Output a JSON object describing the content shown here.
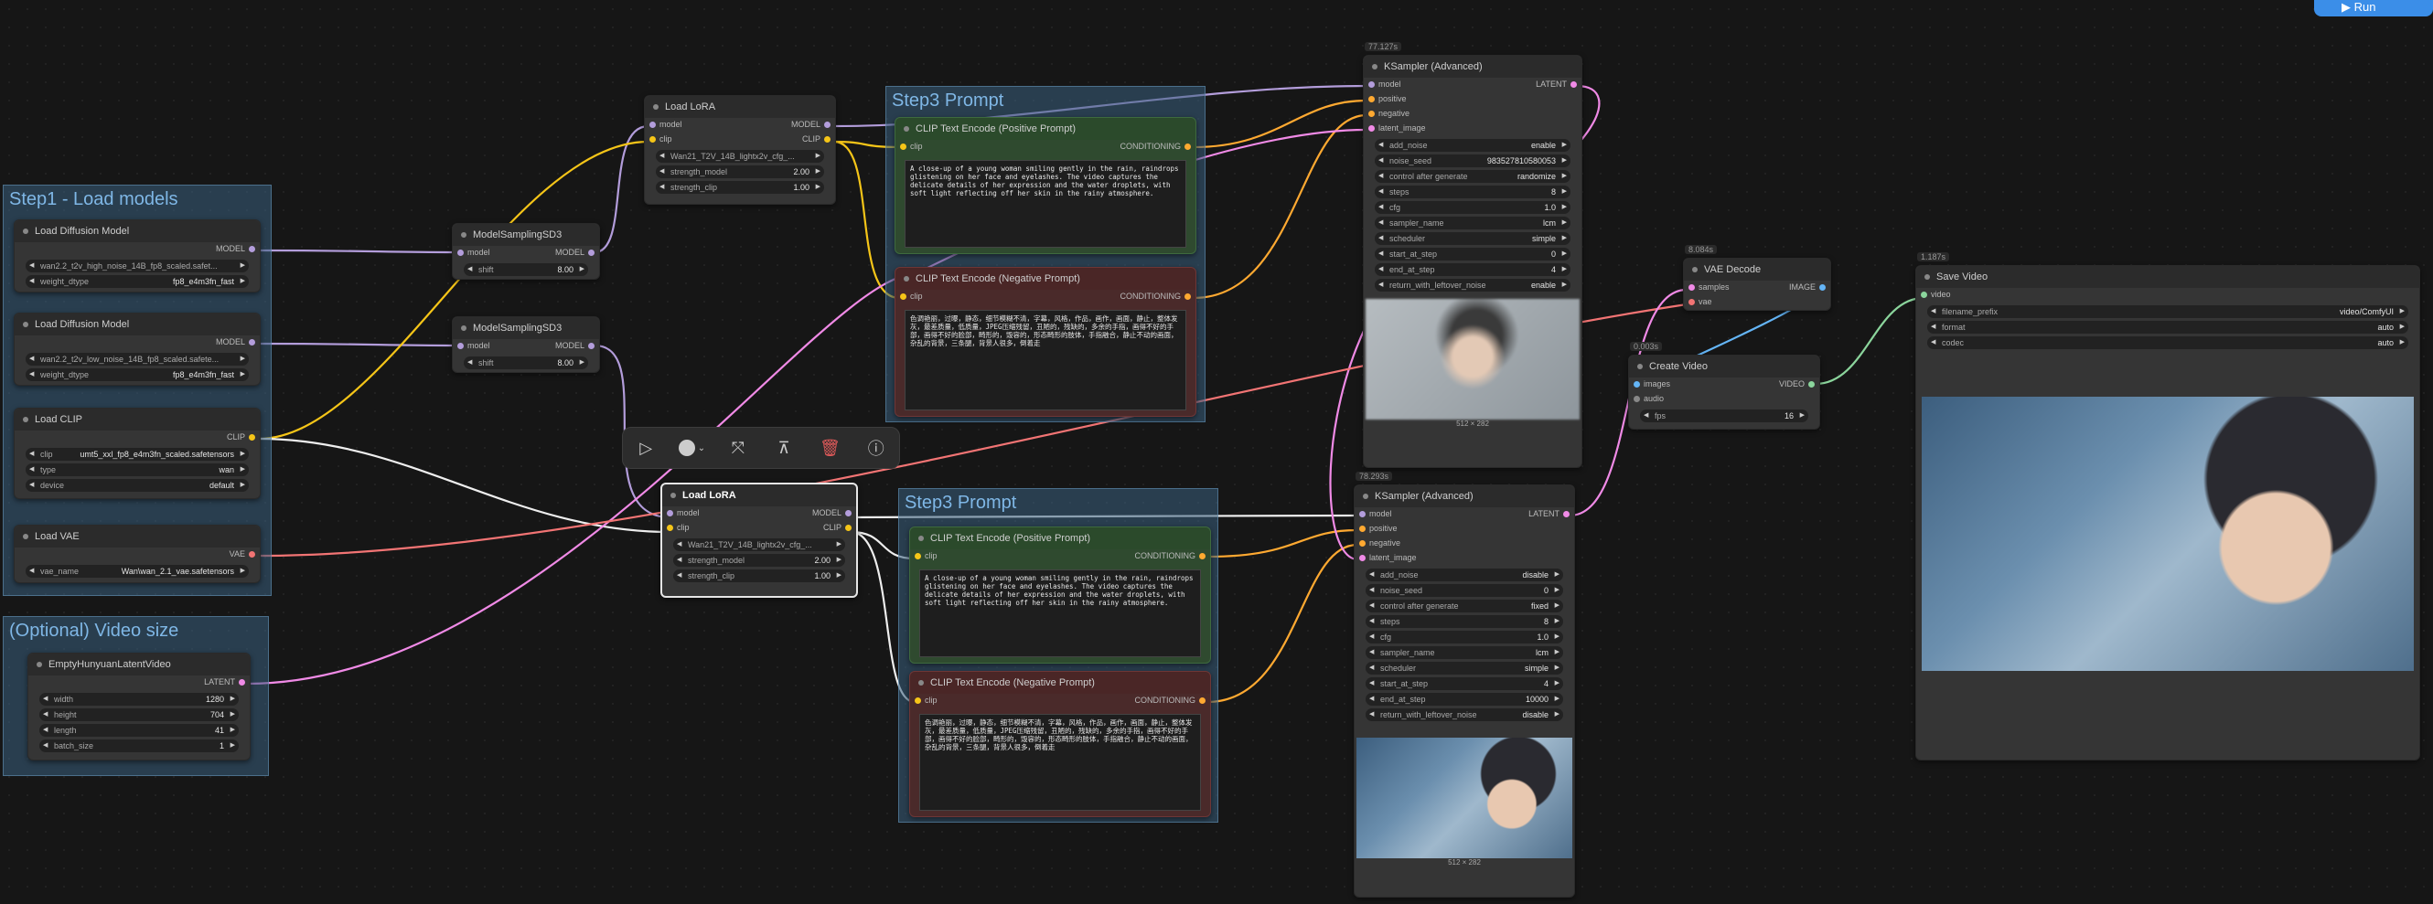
{
  "run_button": {
    "label": "Run"
  },
  "groups": {
    "step1": "Step1 - Load models",
    "video_size": "(Optional) Video size",
    "step3_top": "Step3 Prompt",
    "step3_bottom": "Step3 Prompt"
  },
  "nodes": {
    "ldm_high": {
      "title": "Load Diffusion Model",
      "out": "MODEL",
      "unet_name": "wan2.2_t2v_high_noise_14B_fp8_scaled.safet...",
      "weight_dtype_label": "weight_dtype",
      "weight_dtype": "fp8_e4m3fn_fast"
    },
    "ldm_low": {
      "title": "Load Diffusion Model",
      "out": "MODEL",
      "unet_name": "wan2.2_t2v_low_noise_14B_fp8_scaled.safete...",
      "weight_dtype_label": "weight_dtype",
      "weight_dtype": "fp8_e4m3fn_fast"
    },
    "clip": {
      "title": "Load CLIP",
      "out": "CLIP",
      "clip_label": "clip",
      "clip_name": "umt5_xxl_fp8_e4m3fn_scaled.safetensors",
      "type_label": "type",
      "type": "wan",
      "device_label": "device",
      "device": "default"
    },
    "vae": {
      "title": "Load VAE",
      "out": "VAE",
      "vae_label": "vae_name",
      "vae_name": "Wan\\wan_2.1_vae.safetensors"
    },
    "latent": {
      "title": "EmptyHunyuanLatentVideo",
      "out": "LATENT",
      "width_label": "width",
      "width": "1280",
      "height_label": "height",
      "height": "704",
      "length_label": "length",
      "length": "41",
      "batch_label": "batch_size",
      "batch": "1"
    },
    "msd1": {
      "title": "ModelSamplingSD3",
      "in": "model",
      "out": "MODEL",
      "shift_label": "shift",
      "shift": "8.00"
    },
    "msd2": {
      "title": "ModelSamplingSD3",
      "in": "model",
      "out": "MODEL",
      "shift_label": "shift",
      "shift": "8.00"
    },
    "lora1": {
      "title": "Load LoRA",
      "in1": "model",
      "in2": "clip",
      "out1": "MODEL",
      "out2": "CLIP",
      "lora_name": "Wan21_T2V_14B_lightx2v_cfg_...",
      "sm_label": "strength_model",
      "sm": "2.00",
      "sc_label": "strength_clip",
      "sc": "1.00"
    },
    "lora2": {
      "title": "Load LoRA",
      "in1": "model",
      "in2": "clip",
      "out1": "MODEL",
      "out2": "CLIP",
      "lora_name": "Wan21_T2V_14B_lightx2v_cfg_...",
      "sm_label": "strength_model",
      "sm": "2.00",
      "sc_label": "strength_clip",
      "sc": "1.00"
    },
    "pos1": {
      "title": "CLIP Text Encode (Positive Prompt)",
      "in": "clip",
      "out": "CONDITIONING",
      "text": "A close-up of a young woman smiling gently in the rain, raindrops glistening on her face and eyelashes. The video captures the delicate details of her expression and the water droplets, with soft light reflecting off her skin in the rainy atmosphere."
    },
    "neg1": {
      "title": "CLIP Text Encode (Negative Prompt)",
      "in": "clip",
      "out": "CONDITIONING",
      "text": "色调艳丽，过曝，静态，细节模糊不清，字幕，风格，作品，画作，画面，静止，整体发灰，最差质量，低质量，JPEG压缩残留，丑陋的，残缺的，多余的手指，画得不好的手部，画得不好的脸部，畸形的，毁容的，形态畸形的肢体，手指融合，静止不动的画面，杂乱的背景，三条腿，背景人很多，倒着走"
    },
    "pos2": {
      "title": "CLIP Text Encode (Positive Prompt)",
      "in": "clip",
      "out": "CONDITIONING",
      "text": "A close-up of a young woman smiling gently in the rain, raindrops glistening on her face and eyelashes. The video captures the delicate details of her expression and the water droplets, with soft light reflecting off her skin in the rainy atmosphere."
    },
    "neg2": {
      "title": "CLIP Text Encode (Negative Prompt)",
      "in": "clip",
      "out": "CONDITIONING",
      "text": "色调艳丽，过曝，静态，细节模糊不清，字幕，风格，作品，画作，画面，静止，整体发灰，最差质量，低质量，JPEG压缩残留，丑陋的，残缺的，多余的手指，画得不好的手部，画得不好的脸部，畸形的，毁容的，形态畸形的肢体，手指融合，静止不动的画面，杂乱的背景，三条腿，背景人很多，倒着走"
    },
    "ks1": {
      "badge": "77.127s",
      "title": "KSampler (Advanced)",
      "out": "LATENT",
      "inputs": [
        "model",
        "positive",
        "negative",
        "latent_image"
      ],
      "widgets": [
        [
          "add_noise",
          "enable"
        ],
        [
          "noise_seed",
          "983527810580053"
        ],
        [
          "control after generate",
          "randomize"
        ],
        [
          "steps",
          "8"
        ],
        [
          "cfg",
          "1.0"
        ],
        [
          "sampler_name",
          "lcm"
        ],
        [
          "scheduler",
          "simple"
        ],
        [
          "start_at_step",
          "0"
        ],
        [
          "end_at_step",
          "4"
        ],
        [
          "return_with_leftover_noise",
          "enable"
        ]
      ],
      "preview_caption": "512 × 282"
    },
    "ks2": {
      "badge": "78.293s",
      "title": "KSampler (Advanced)",
      "out": "LATENT",
      "inputs": [
        "model",
        "positive",
        "negative",
        "latent_image"
      ],
      "widgets": [
        [
          "add_noise",
          "disable"
        ],
        [
          "noise_seed",
          "0"
        ],
        [
          "control after generate",
          "fixed"
        ],
        [
          "steps",
          "8"
        ],
        [
          "cfg",
          "1.0"
        ],
        [
          "sampler_name",
          "lcm"
        ],
        [
          "scheduler",
          "simple"
        ],
        [
          "start_at_step",
          "4"
        ],
        [
          "end_at_step",
          "10000"
        ],
        [
          "return_with_leftover_noise",
          "disable"
        ]
      ],
      "preview_caption": "512 × 282"
    },
    "vaedec": {
      "badge": "8.084s",
      "title": "VAE Decode",
      "in1": "samples",
      "in2": "vae",
      "out": "IMAGE"
    },
    "create": {
      "badge": "0.003s",
      "title": "Create Video",
      "in1": "images",
      "in2": "audio",
      "out": "VIDEO",
      "fps_label": "fps",
      "fps": "16"
    },
    "save": {
      "badge": "1.187s",
      "title": "Save Video",
      "in": "video",
      "fp_label": "filename_prefix",
      "fp": "video/ComfyUI",
      "format_label": "format",
      "format": "auto",
      "codec_label": "codec",
      "codec": "auto"
    }
  },
  "colors": {
    "model": "#b39ddb",
    "clip": "#f5c518",
    "vae": "#f27474",
    "latent": "#f08ae6",
    "conditioning": "#ffa931",
    "image": "#64b5f6",
    "video": "#8bd59c"
  }
}
